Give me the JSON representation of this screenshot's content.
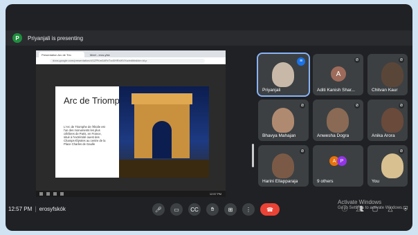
{
  "presenter": {
    "badge": "P",
    "text": "Priyanjali is presenting"
  },
  "browser": {
    "tabs": [
      "Presentation Arc de Trio",
      "Meet - eros-yfsk"
    ],
    "address": "docs.google.com/presentation/d/1ZPKm0ARxTxd0HRxWVXw/edit#slide=id.p"
  },
  "slide": {
    "title": "Arc de Triomphe",
    "body": "L'Arc de Triomphe de l'Étoile est l'un des monuments les plus célèbres de Paris, en France, situé à l'extrémité ouest des Champs-Élysées au centre de la Place Charles de Gaulle"
  },
  "taskbar": {
    "time": "12:57 PM"
  },
  "participants": [
    {
      "name": "Priyanjali",
      "mic": "on"
    },
    {
      "name": "Aditi Kanish Shar...",
      "mic": "off",
      "initial": "A"
    },
    {
      "name": "Chitvan Kaur",
      "mic": "off"
    },
    {
      "name": "Bhavya Mahajan",
      "mic": "off"
    },
    {
      "name": "Anwesha Dogra",
      "mic": "off"
    },
    {
      "name": "Anika Arora",
      "mic": "off"
    },
    {
      "name": "Harini Ellapparaja",
      "mic": "off"
    },
    {
      "name": "9 others",
      "initials": [
        "A",
        "P"
      ]
    },
    {
      "name": "You",
      "mic": "off"
    }
  ],
  "bottom": {
    "clock": "12:57 PM",
    "separator": "|",
    "meeting_code": "erosyfskók"
  },
  "watermark": {
    "line1": "Activate Windows",
    "line2": "Go to Settings to activate Windows."
  }
}
